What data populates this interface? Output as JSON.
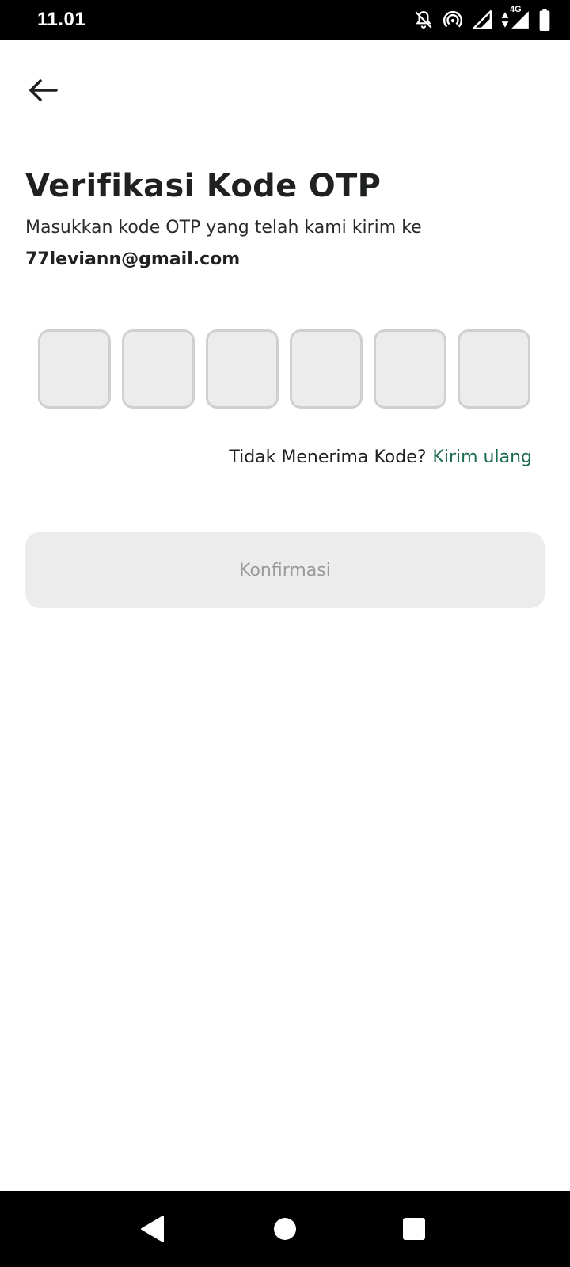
{
  "status_bar": {
    "time": "11.01",
    "network_label": "4G",
    "icons": [
      "notifications-off-icon",
      "hotspot-icon",
      "signal-icon",
      "mobile-data-icon",
      "battery-icon"
    ]
  },
  "header": {
    "back_icon": "arrow-left-icon"
  },
  "main": {
    "title": "Verifikasi Kode OTP",
    "subtitle": "Masukkan kode OTP yang telah kami kirim ke",
    "email": "77leviann@gmail.com",
    "otp_digits": [
      "",
      "",
      "",
      "",
      "",
      ""
    ],
    "resend_prompt": "Tidak Menerima Kode?",
    "resend_link": "Kirim ulang",
    "confirm_label": "Konfirmasi"
  },
  "colors": {
    "accent": "#1b6b4f",
    "input_bg": "#ececec",
    "input_border": "#d0d0d0",
    "button_disabled_bg": "#ececec",
    "button_disabled_text": "#9a9a9a"
  },
  "nav_bar": {
    "icons": [
      "back-triangle-icon",
      "home-circle-icon",
      "recents-square-icon"
    ]
  }
}
